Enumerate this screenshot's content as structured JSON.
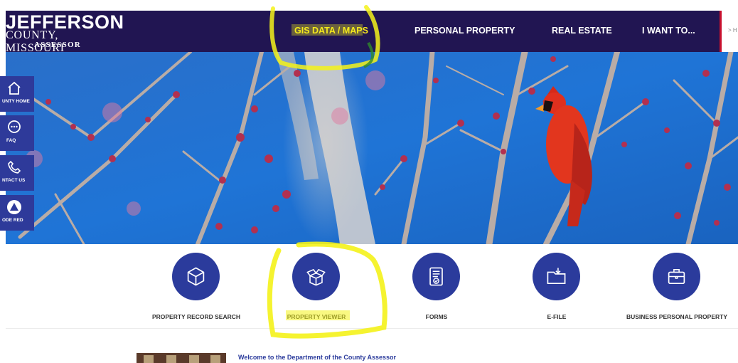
{
  "header": {
    "logo": {
      "line1": "JEFFERSON",
      "line2": "COUNTY, MISSOURI",
      "line3": "ASSESSOR"
    },
    "nav": [
      {
        "label": "GIS DATA / MAPS",
        "active": true
      },
      {
        "label": "PERSONAL PROPERTY",
        "active": false
      },
      {
        "label": "REAL ESTATE",
        "active": false
      },
      {
        "label": "I WANT TO...",
        "active": false
      }
    ],
    "right_fragment": "> H"
  },
  "quick_links": [
    {
      "label": "UNTY HOME",
      "icon": "home-icon"
    },
    {
      "label": "FAQ",
      "icon": "chat-icon"
    },
    {
      "label": "NTACT US",
      "icon": "phone-icon"
    },
    {
      "label": "ODE RED",
      "icon": "alert-icon"
    }
  ],
  "services": [
    {
      "label": "PROPERTY RECORD SEARCH",
      "icon": "cube-icon"
    },
    {
      "label": "PROPERTY VIEWER",
      "icon": "open-box-icon"
    },
    {
      "label": "FORMS",
      "icon": "checklist-icon"
    },
    {
      "label": "E-FILE",
      "icon": "folder-download-icon"
    },
    {
      "label": "BUSINESS PERSONAL PROPERTY",
      "icon": "briefcase-icon"
    }
  ],
  "welcome": {
    "heading": "Welcome to the Department of the County Assessor"
  },
  "colors": {
    "header_bg": "#211552",
    "active_nav": "#f6e71d",
    "accent_blue": "#2b3b9c",
    "quick_link_bg": "#2e3a9a",
    "highlighter": "#f4f21a",
    "sky": "#1f6fd0",
    "cardinal": "#e0301e"
  }
}
